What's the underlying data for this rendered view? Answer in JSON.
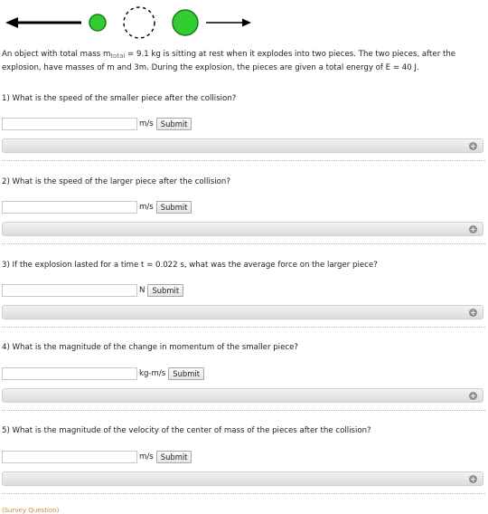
{
  "problem": {
    "intro_part1": "An object with total mass m",
    "intro_sub": "total",
    "intro_part2": " = 9.1 kg is sitting at rest when it explodes into two pieces. The two pieces, after the explosion, have masses of m and 3m. During the explosion, the pieces are given a total energy of E = 40 J."
  },
  "questions": [
    {
      "text": "1) What is the speed of the smaller piece after the collision?",
      "value": "",
      "unit": "m/s",
      "submit_label": "Submit",
      "expand_symbol": "+"
    },
    {
      "text": "2) What is the speed of the larger piece after the collision?",
      "value": "",
      "unit": "m/s",
      "submit_label": "Submit",
      "expand_symbol": "+"
    },
    {
      "text": "3) If the explosion lasted for a time t = 0.022 s, what was the average force on the larger piece?",
      "value": "",
      "unit": "N",
      "submit_label": "Submit",
      "expand_symbol": "+"
    },
    {
      "text": "4) What is the magnitude of the change in momentum of the smaller piece?",
      "value": "",
      "unit": "kg-m/s",
      "submit_label": "Submit",
      "expand_symbol": "+"
    },
    {
      "text": "5) What is the magnitude of the velocity of the center of mass of the pieces after the collision?",
      "value": "",
      "unit": "m/s",
      "submit_label": "Submit",
      "expand_symbol": "+"
    }
  ],
  "footer": {
    "survey_label": "(Survey Question)"
  },
  "colors": {
    "piece_fill": "#33cc33",
    "piece_stroke": "#1a7a1a",
    "link": "#d08a3a"
  }
}
